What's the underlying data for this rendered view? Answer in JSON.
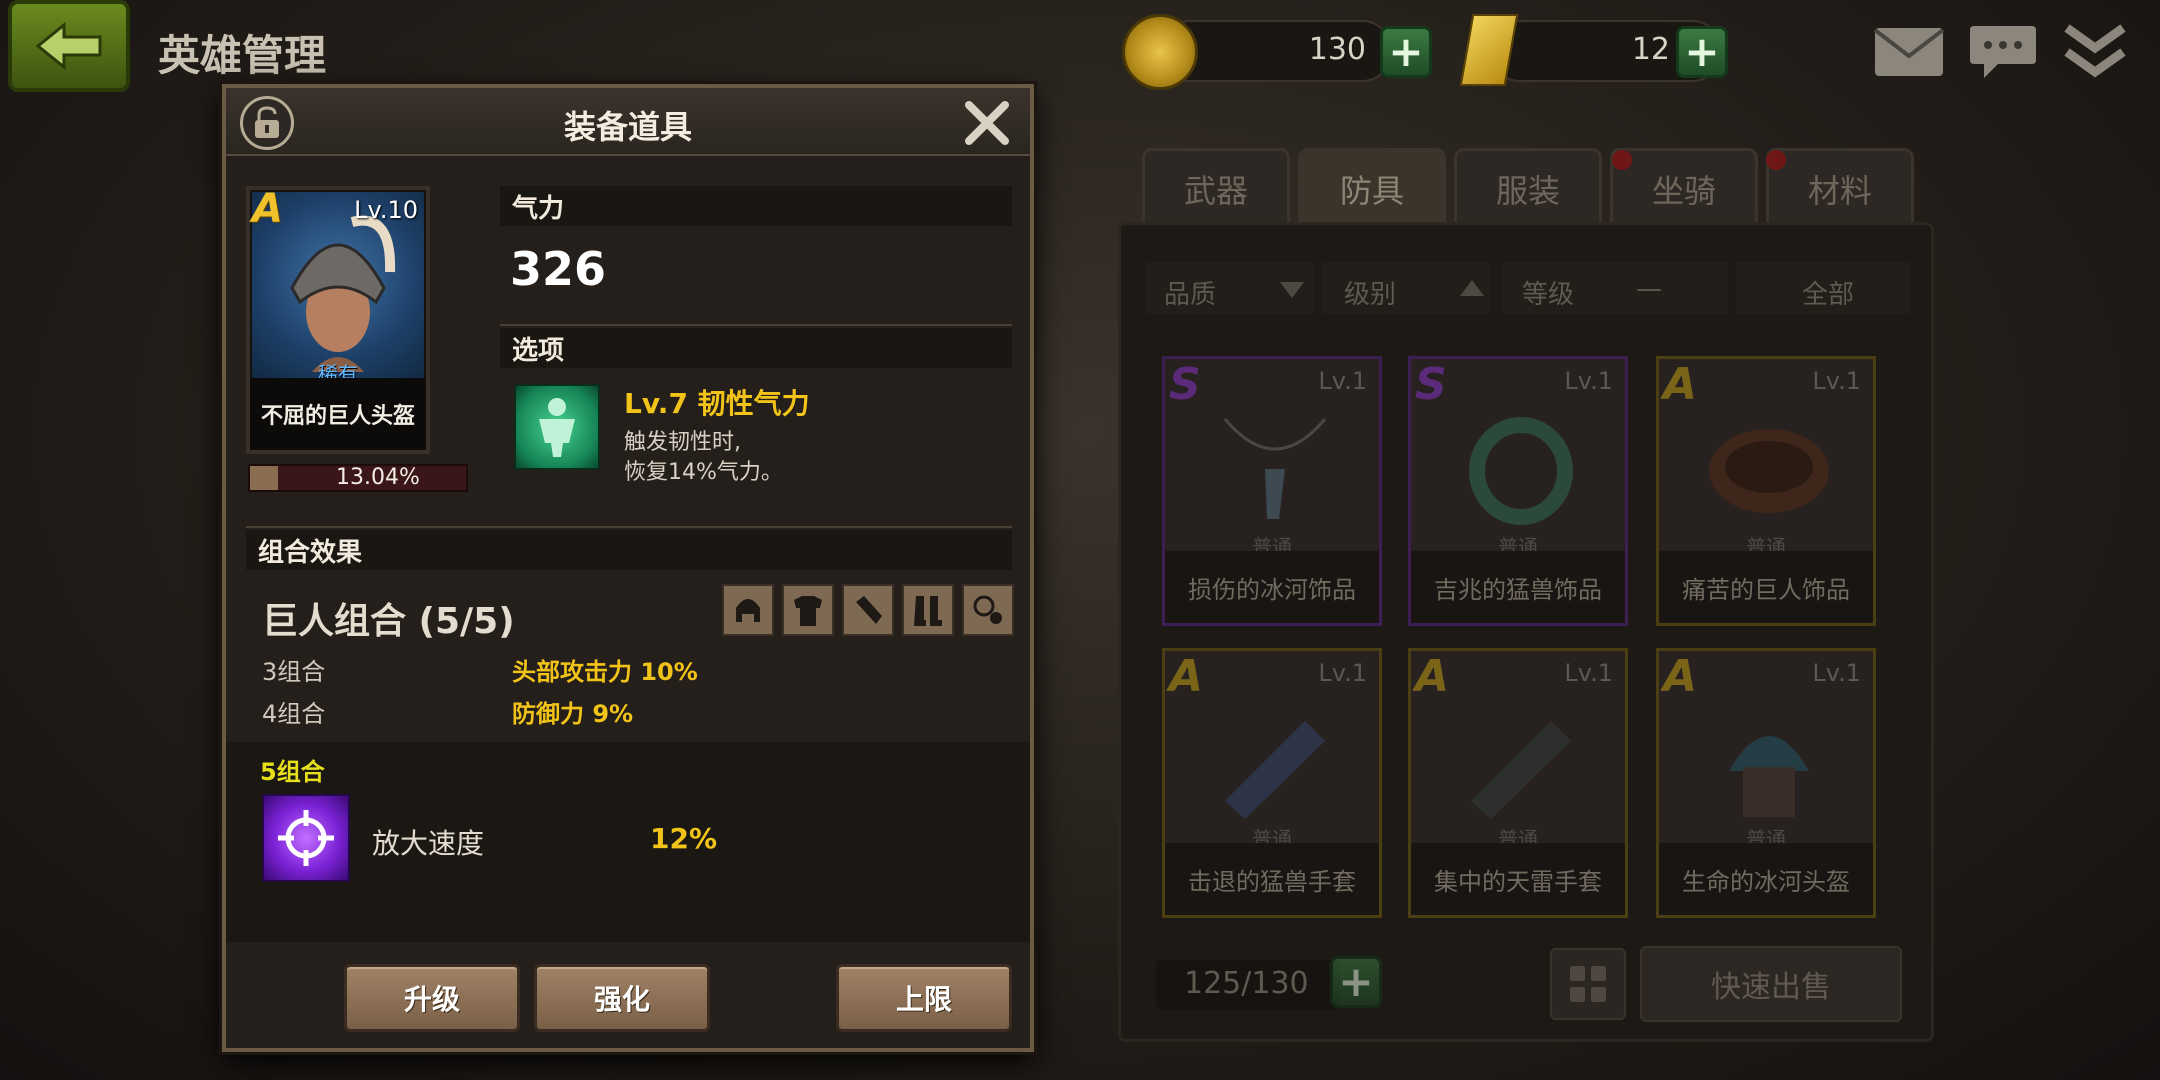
{
  "top_bar": {
    "screen_title": "英雄管理",
    "gold_value": "130",
    "gem_value": "12"
  },
  "inventory": {
    "tabs": [
      {
        "label": "武器"
      },
      {
        "label": "防具"
      },
      {
        "label": "服装"
      },
      {
        "label": "坐骑"
      },
      {
        "label": "材料"
      }
    ],
    "filters": {
      "quality": "品质",
      "tier": "级别",
      "level": "等级",
      "dash": "—",
      "all": "全部"
    },
    "items": [
      {
        "grade": "S",
        "level": "Lv.1",
        "rarity": "普通",
        "name": "损伤的冰河饰品"
      },
      {
        "grade": "S",
        "level": "Lv.1",
        "rarity": "普通",
        "name": "吉兆的猛兽饰品"
      },
      {
        "grade": "A",
        "level": "Lv.1",
        "rarity": "普通",
        "name": "痛苦的巨人饰品"
      },
      {
        "grade": "A",
        "level": "Lv.1",
        "rarity": "普通",
        "name": "击退的猛兽手套"
      },
      {
        "grade": "A",
        "level": "Lv.1",
        "rarity": "普通",
        "name": "集中的天雷手套"
      },
      {
        "grade": "A",
        "level": "Lv.1",
        "rarity": "普通",
        "name": "生命的冰河头盔"
      }
    ],
    "capacity": "125/130",
    "quick_sell_label": "快速出售",
    "colors": {
      "grade_S": "#5b2a7a",
      "grade_A": "#7a6418"
    }
  },
  "dialog": {
    "title": "装备道具",
    "item": {
      "grade": "A",
      "level": "Lv.10",
      "rarity": "稀有",
      "name": "不屈的巨人头盔",
      "exp_percent_text": "13.04%",
      "exp_fraction": 0.1304
    },
    "stat_section_label": "气力",
    "stat_value": "326",
    "option_section_label": "选项",
    "option": {
      "title": "Lv.7 韧性气力",
      "desc_line1": "触发韧性时,",
      "desc_line2": "恢复14%气力。"
    },
    "set_section_label": "组合效果",
    "set_name": "巨人组合 (5/5)",
    "set_bonuses": [
      {
        "label": "3组合",
        "value": "头部攻击力 10%"
      },
      {
        "label": "4组合",
        "value": "防御力 9%"
      }
    ],
    "set5": {
      "label": "5组合",
      "stat": "放大速度",
      "value": "12%"
    },
    "buttons": {
      "upgrade": "升级",
      "enhance": "强化",
      "limit": "上限"
    },
    "colors": {
      "gold_text": "#f2c319",
      "rare_blue": "#62b7ff",
      "set5_yellow": "#e6df1b"
    }
  }
}
